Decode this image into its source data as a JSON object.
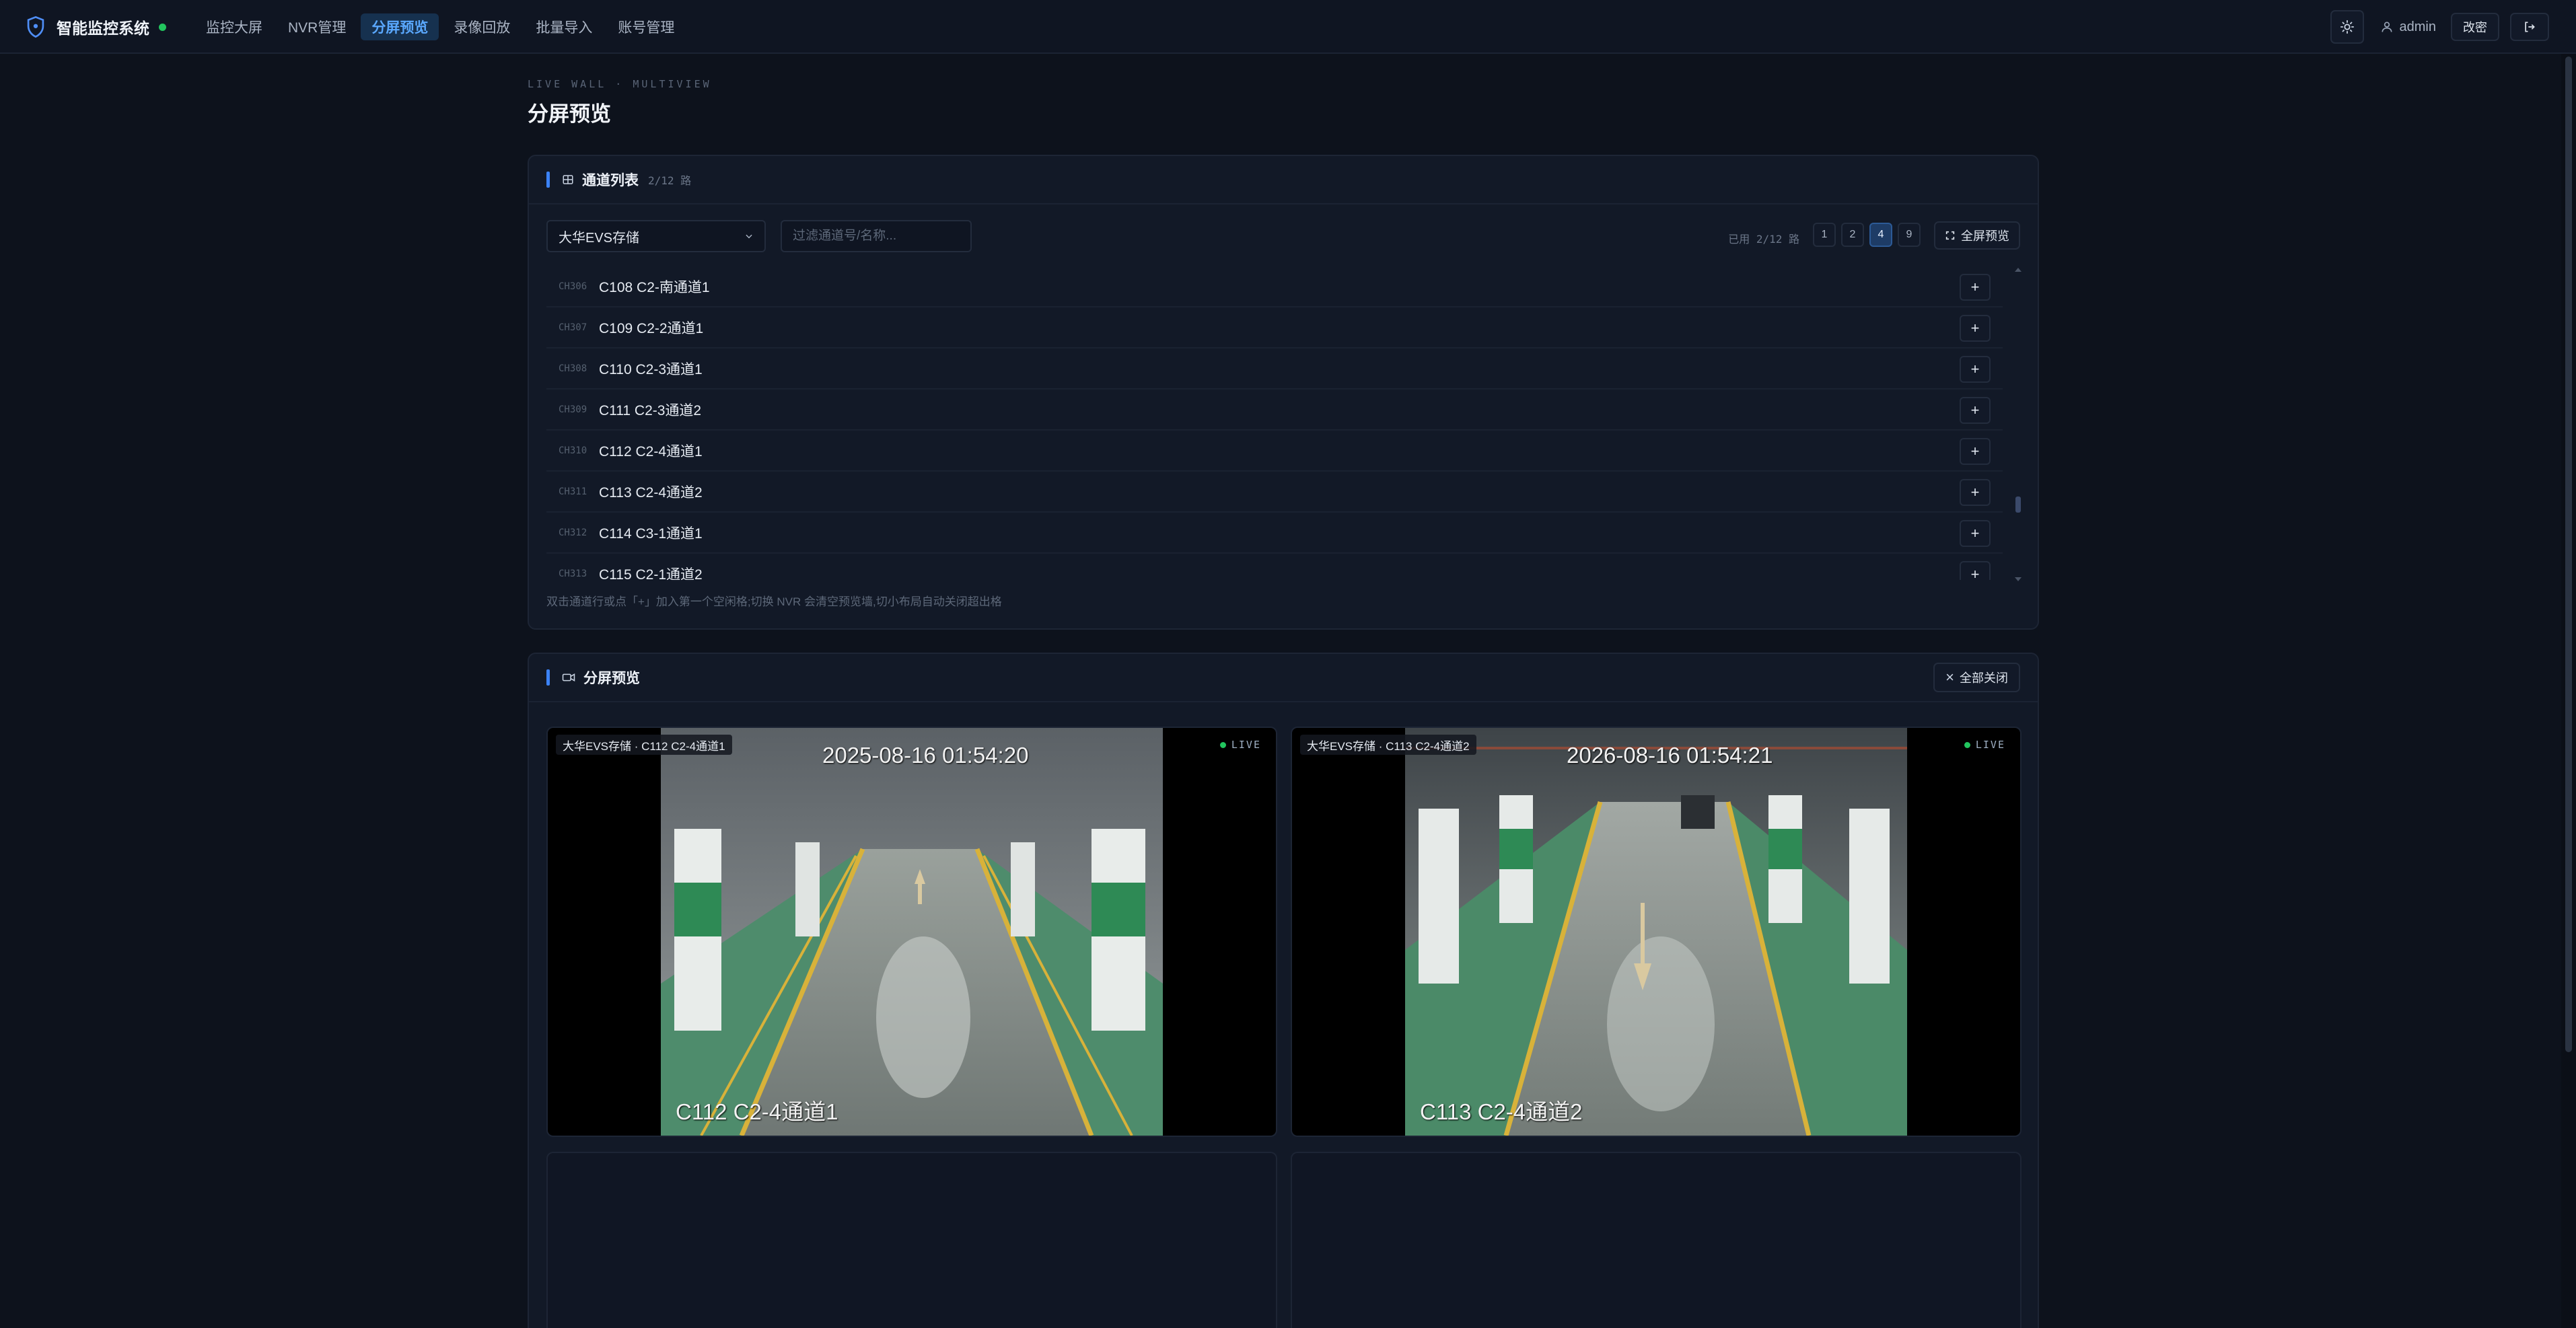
{
  "app": {
    "title": "智能监控系统",
    "status_color": "#22c55e"
  },
  "nav": [
    {
      "label": "监控大屏",
      "active": false
    },
    {
      "label": "NVR管理",
      "active": false
    },
    {
      "label": "分屏预览",
      "active": true
    },
    {
      "label": "录像回放",
      "active": false
    },
    {
      "label": "批量导入",
      "active": false
    },
    {
      "label": "账号管理",
      "active": false
    }
  ],
  "header_right": {
    "theme_icon": "sun-icon",
    "user_icon": "user-icon",
    "username": "admin",
    "change_password_label": "改密",
    "logout_icon": "logout-icon"
  },
  "page": {
    "eyebrow": "LIVE WALL · MULTIVIEW",
    "title": "分屏预览"
  },
  "channel_card": {
    "icon": "list-icon",
    "title": "通道列表",
    "count": "2/12 路",
    "nvr_select": "大华EVS存储",
    "filter_placeholder": "过滤通道号/名称...",
    "used_label": "已用 2/12 路",
    "layouts": [
      "1",
      "2",
      "4",
      "9"
    ],
    "active_layout": "4",
    "fullscreen_label": "全屏预览",
    "hint": "双击通道行或点「+」加入第一个空闲格;切换 NVR 会清空预览墙,切小布局自动关闭超出格",
    "add_label": "+",
    "channels": [
      {
        "ch": "CH306",
        "name": "C108 C2-南通道1"
      },
      {
        "ch": "CH307",
        "name": "C109 C2-2通道1"
      },
      {
        "ch": "CH308",
        "name": "C110 C2-3通道1"
      },
      {
        "ch": "CH309",
        "name": "C111 C2-3通道2"
      },
      {
        "ch": "CH310",
        "name": "C112 C2-4通道1"
      },
      {
        "ch": "CH311",
        "name": "C113 C2-4通道2"
      },
      {
        "ch": "CH312",
        "name": "C114 C3-1通道1"
      },
      {
        "ch": "CH313",
        "name": "C115 C2-1通道2"
      }
    ]
  },
  "preview_card": {
    "icon": "camera-icon",
    "title": "分屏预览",
    "close_all_label": "全部关闭",
    "live_label": "LIVE",
    "tiles": [
      {
        "label": "大华EVS存储 · C112 C2-4通道1",
        "osd_time": "2025-08-16 01:54:20",
        "osd_name": "C112 C2-4通道1"
      },
      {
        "label": "大华EVS存储 · C113 C2-4通道2",
        "osd_time": "2026-08-16 01:54:21",
        "osd_name": "C113 C2-4通道2"
      }
    ]
  },
  "colors": {
    "accent": "#3b82f6",
    "live": "#22c55e",
    "background": "#0d121c"
  }
}
